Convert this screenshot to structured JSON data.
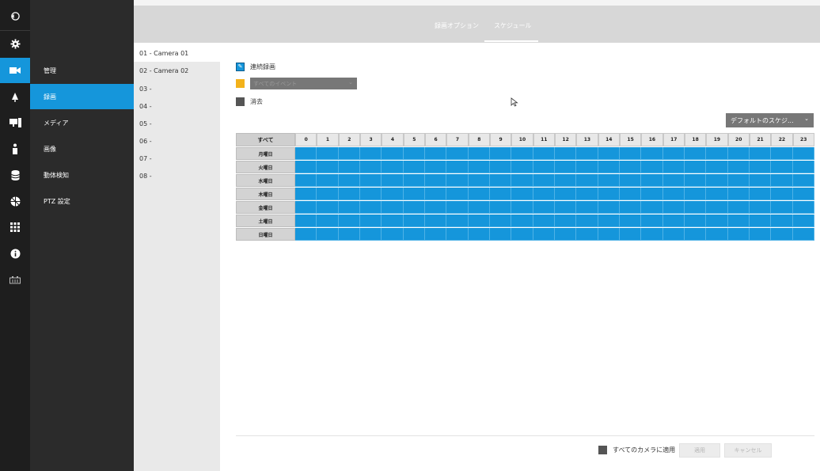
{
  "rail": {
    "icons": [
      "back-icon",
      "gear-icon",
      "camera-icon",
      "bell-icon",
      "monitor-icon",
      "person-icon",
      "database-icon",
      "network-icon",
      "grid-icon",
      "info-icon",
      "device-icon"
    ]
  },
  "submenu": {
    "items": [
      "管理",
      "録画",
      "メディア",
      "画像",
      "動体検知",
      "PTZ 設定"
    ]
  },
  "header": {
    "tabs": [
      "録画オプション",
      "スケジュール"
    ]
  },
  "cameras": {
    "items": [
      "01 - Camera 01",
      "02 - Camera 02",
      "03 -",
      "04 -",
      "05 -",
      "06 -",
      "07 -",
      "08 -"
    ]
  },
  "modes": {
    "continuous": "連続録画",
    "event_placeholder": "すべてのイベント",
    "erase": "消去"
  },
  "default_schedule": "デフォルトのスケジ...",
  "grid": {
    "corner": "すべて",
    "hours": [
      "0",
      "1",
      "2",
      "3",
      "4",
      "5",
      "6",
      "7",
      "8",
      "9",
      "10",
      "11",
      "12",
      "13",
      "14",
      "15",
      "16",
      "17",
      "18",
      "19",
      "20",
      "21",
      "22",
      "23"
    ],
    "days": [
      "月曜日",
      "火曜日",
      "水曜日",
      "木曜日",
      "金曜日",
      "土曜日",
      "日曜日"
    ]
  },
  "footer": {
    "apply_all": "すべてのカメラに適用",
    "apply": "適用",
    "cancel": "キャンセル"
  },
  "colors": {
    "accent": "#1596db",
    "event": "#f3b21b",
    "erase": "#555555"
  }
}
